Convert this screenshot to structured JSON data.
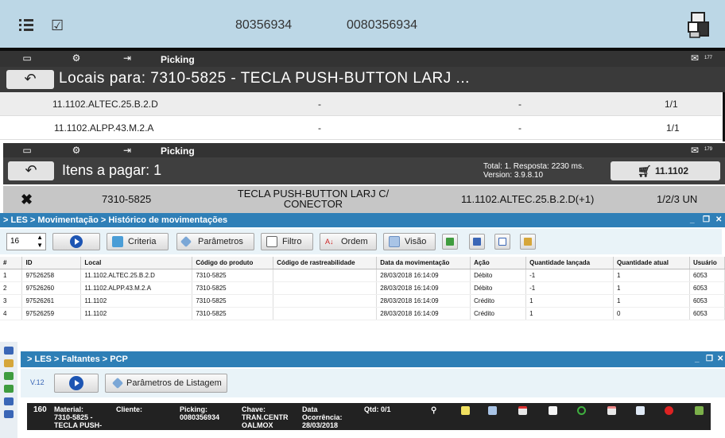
{
  "top_panel": {
    "code_a": "80356934",
    "code_b": "0080356934",
    "icons": [
      "list-icon",
      "checkbox-icon",
      "boxes-icon"
    ]
  },
  "locations_panel": {
    "toolbar_label": "Picking",
    "message_count": "177",
    "title": "Locais para: 7310-5825 - TECLA PUSH-BUTTON LARJ ...",
    "rows": [
      {
        "location": "11.1102.ALTEC.25.B.2.D",
        "c2": "-",
        "c3": "-",
        "qty": "1/1"
      },
      {
        "location": "11.1102.ALPP.43.M.2.A",
        "c2": "-",
        "c3": "-",
        "qty": "1/1"
      }
    ]
  },
  "items_panel": {
    "toolbar_label": "Picking",
    "message_count": "179",
    "title": "Itens a pagar: 1",
    "totals_line1": "Total: 1. Resposta: 2230 ms.",
    "totals_line2": "Version: 3.9.8.10",
    "location_button": "11.1102",
    "item": {
      "code": "7310-5825",
      "desc_line1": "TECLA PUSH-BUTTON LARJ C/",
      "desc_line2": "CONECTOR",
      "location": "11.1102.ALTEC.25.B.2.D(+1)",
      "qty": "1/2/3 UN"
    }
  },
  "history_panel": {
    "breadcrumb": "> LES > Movimentação > Histórico de movimentações",
    "page_size": "16",
    "buttons": {
      "criteria": "Criteria",
      "params": "Parâmetros",
      "filter": "Filtro",
      "order": "Ordem",
      "view": "Visão"
    },
    "columns": [
      "#",
      "ID",
      "Local",
      "Código do produto",
      "Código de rastreabilidade",
      "Data da movimentação",
      "Ação",
      "Quantidade lançada",
      "Quantidade atual",
      "Usuário"
    ],
    "rows": [
      [
        "1",
        "97526258",
        "11.1102.ALTEC.25.B.2.D",
        "7310-5825",
        "",
        "28/03/2018 16:14:09",
        "Débito",
        "-1",
        "1",
        "6053"
      ],
      [
        "2",
        "97526260",
        "11.1102.ALPP.43.M.2.A",
        "7310-5825",
        "",
        "28/03/2018 16:14:09",
        "Débito",
        "-1",
        "1",
        "6053"
      ],
      [
        "3",
        "97526261",
        "11.1102",
        "7310-5825",
        "",
        "28/03/2018 16:14:09",
        "Crédito",
        "1",
        "1",
        "6053"
      ],
      [
        "4",
        "97526259",
        "11.1102",
        "7310-5825",
        "",
        "28/03/2018 16:14:09",
        "Crédito",
        "1",
        "0",
        "6053"
      ]
    ]
  },
  "shortage_panel": {
    "breadcrumb": "> LES > Faltantes > PCP",
    "version": "V.12",
    "params_button": "Parâmetros de Listagem",
    "row": {
      "number": "160",
      "material_label": "Material:",
      "material_line1": "7310-5825 -",
      "material_line2": "TECLA PUSH-",
      "client_label": "Cliente:",
      "picking_label": "Picking:",
      "picking_value": "0080356934",
      "key_label": "Chave:",
      "key_line1": "TRAN.CENTR",
      "key_line2": "OALMOX",
      "date_label": "Data",
      "date_label2": "Ocorrência:",
      "date_value": "28/03/2018",
      "qty": "Qtd: 0/1"
    }
  }
}
